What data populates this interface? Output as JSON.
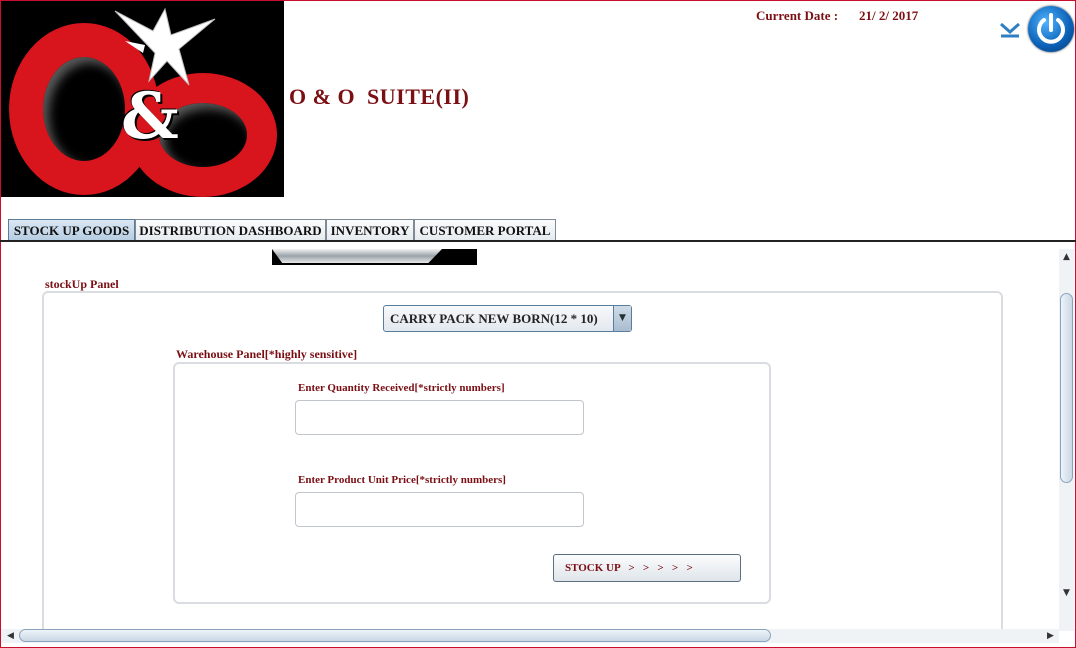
{
  "app": {
    "title": "O & O  SUITE(II)",
    "logo_text": "O&O",
    "current_date_label": "Current Date :",
    "current_date_value": "21/ 2/ 2017"
  },
  "tabs": [
    {
      "label": "STOCK UP GOODS",
      "active": true
    },
    {
      "label": "DISTRIBUTION DASHBOARD",
      "active": false
    },
    {
      "label": "INVENTORY",
      "active": false
    },
    {
      "label": "CUSTOMER PORTAL",
      "active": false
    }
  ],
  "stock_panel": {
    "caption": "stockUp Panel",
    "product_select_value": "CARRY PACK NEW BORN(12 * 10)",
    "warehouse_caption": "Warehouse Panel[*highly sensitive]",
    "quantity_label": "Enter Quantity Received[*strictly numbers]",
    "quantity_value": "",
    "price_label": "Enter Product Unit Price[*strictly numbers]",
    "price_value": "",
    "stock_button_label": "STOCK UP   >   >   >   >   >"
  },
  "icons": {
    "minimize": "chevron-down-icon",
    "power": "power-icon",
    "select_arrow": "caret-down-icon"
  },
  "colors": {
    "accent": "#7a0f14",
    "logo_red": "#d8141c",
    "power_blue": "#0a5fb4"
  }
}
